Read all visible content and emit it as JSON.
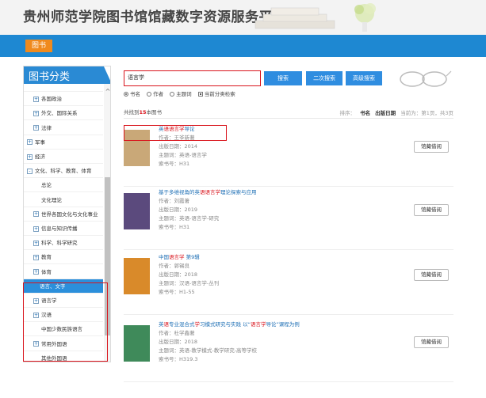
{
  "header": {
    "title": "贵州师范学院图书馆馆藏数字资源服务平台"
  },
  "nav": {
    "tab_label": "图书"
  },
  "sidebar": {
    "title": "图书分类",
    "items": [
      {
        "label": "",
        "level": "l1",
        "toggle": ""
      },
      {
        "label": "各国政治",
        "level": "l1",
        "toggle": "+"
      },
      {
        "label": "外交、国际关系",
        "level": "l1",
        "toggle": "+"
      },
      {
        "label": "法律",
        "level": "l1",
        "toggle": "+"
      },
      {
        "label": "军事",
        "level": "l0",
        "toggle": "+"
      },
      {
        "label": "经济",
        "level": "l0",
        "toggle": "+"
      },
      {
        "label": "文化、科学、教育、体育",
        "level": "l0",
        "toggle": "-"
      },
      {
        "label": "总论",
        "level": "l2",
        "toggle": ""
      },
      {
        "label": "文化理论",
        "level": "l2",
        "toggle": ""
      },
      {
        "label": "世界各国文化与文化事业",
        "level": "l1",
        "toggle": "+"
      },
      {
        "label": "信息与知识传播",
        "level": "l1",
        "toggle": "+"
      },
      {
        "label": "科学、科学研究",
        "level": "l1",
        "toggle": "+"
      },
      {
        "label": "教育",
        "level": "l1",
        "toggle": "+"
      },
      {
        "label": "体育",
        "level": "l1",
        "toggle": "+"
      },
      {
        "label": "语言、文字",
        "level": "active",
        "toggle": ""
      },
      {
        "label": "语言学",
        "level": "l1",
        "toggle": "+"
      },
      {
        "label": "汉语",
        "level": "l1",
        "toggle": "+"
      },
      {
        "label": "中国少数民族语言",
        "level": "l2",
        "toggle": ""
      },
      {
        "label": "常用外国语",
        "level": "l1",
        "toggle": "+"
      },
      {
        "label": "其他外国语",
        "level": "l2",
        "toggle": ""
      }
    ]
  },
  "search": {
    "value": "语言学",
    "search_label": "搜索",
    "second_label": "二次搜索",
    "advanced_label": "高级搜索",
    "options": {
      "title": "书名",
      "author": "作者",
      "subject": "主题词",
      "current_cat": "当前分类检索"
    }
  },
  "results": {
    "prefix": "共找到",
    "count": "15",
    "suffix": "本图书",
    "sort_label": "排序：",
    "sort_title": "书名",
    "sort_date": "出版日期",
    "page_info": "当前为：第1页，共3页",
    "borrow_label": "馆藏借阅",
    "books": [
      {
        "title_pre": "英",
        "title_hl": "语语言学",
        "title_post": "导论",
        "author": "作者：王爷新著",
        "date": "出版日期：2014",
        "subject": "主题词：英语-语言学",
        "call_no": "索书号：H31",
        "cover_color": "#c9a878"
      },
      {
        "title_pre": "基于多维视角的英",
        "title_hl": "语语言学",
        "title_post": "理论探索与应用",
        "author": "作者：刘霞著",
        "date": "出版日期：2019",
        "subject": "主题词：英语-语言学-研究",
        "call_no": "索书号：H31",
        "cover_color": "#5b4a7d"
      },
      {
        "title_pre": "中国",
        "title_hl": "语言学",
        "title_post": " 第9辑",
        "author": "作者：郭锡良",
        "date": "出版日期：2018",
        "subject": "主题词：汉语-语言学-丛刊",
        "call_no": "索书号：H1-55",
        "cover_color": "#d98a2a"
      },
      {
        "title_pre": "英",
        "title_hl": "语",
        "title_post": "专业混合式",
        "title_hl2": "学",
        "title_post2": "习模式研究与实践 以“",
        "title_hl3": "语言学",
        "title_post3": "导论”课程为例",
        "author": "作者：杜学鑫著",
        "date": "出版日期：2018",
        "subject": "主题词：英语-教学模式-教学研究-高等学校",
        "call_no": "索书号：H319.3",
        "cover_color": "#3f8a5a"
      }
    ]
  }
}
